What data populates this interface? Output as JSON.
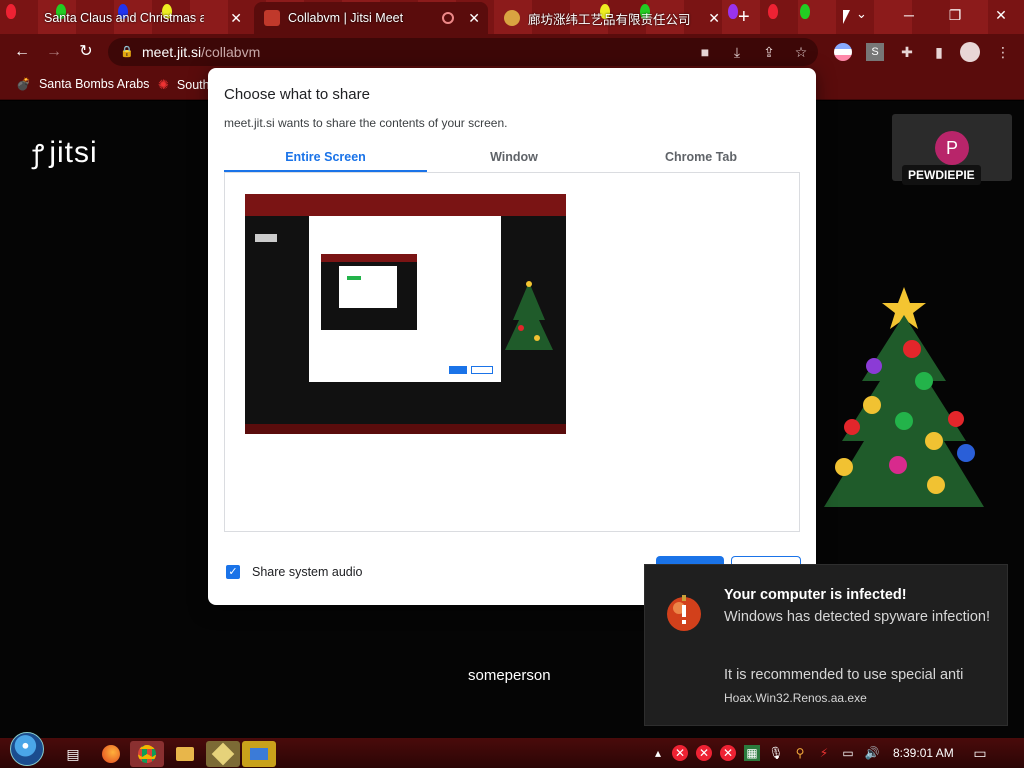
{
  "browser": {
    "tabs": [
      {
        "title": "Santa Claus and Christmas at the",
        "active": false
      },
      {
        "title": "Collabvm | Jitsi Meet",
        "active": true
      },
      {
        "title": "廊坊涨纬工艺品有限责任公司",
        "active": false
      }
    ],
    "new_tab_symbol": "+",
    "url_host": "meet.jit.si",
    "url_path": "/collabvm",
    "bookmarks": [
      {
        "label": "Santa Bombs Arabs"
      },
      {
        "label": "South"
      }
    ]
  },
  "page": {
    "logo_text": "jitsi",
    "participant_initial": "P",
    "participant_name": "PEWDIEPIE",
    "speaker_name": "someperson"
  },
  "dialog": {
    "title": "Choose what to share",
    "subtitle": "meet.jit.si wants to share the contents of your screen.",
    "tabs": [
      {
        "label": "Entire Screen",
        "selected": true
      },
      {
        "label": "Window",
        "selected": false
      },
      {
        "label": "Chrome Tab",
        "selected": false
      }
    ],
    "audio_checkbox_label": "Share system audio",
    "audio_checked": true
  },
  "toast": {
    "title": "Your computer is infected!",
    "message": "Windows has detected spyware infection!",
    "message2": "It is recommended to use special anti",
    "file": "Hoax.Win32.Renos.aa.exe"
  },
  "taskbar": {
    "clock": "8:39:01 AM"
  },
  "colors": {
    "accent": "#1a73e8",
    "browser_frame": "#5a0c0c",
    "avatar": "#b8256a"
  }
}
